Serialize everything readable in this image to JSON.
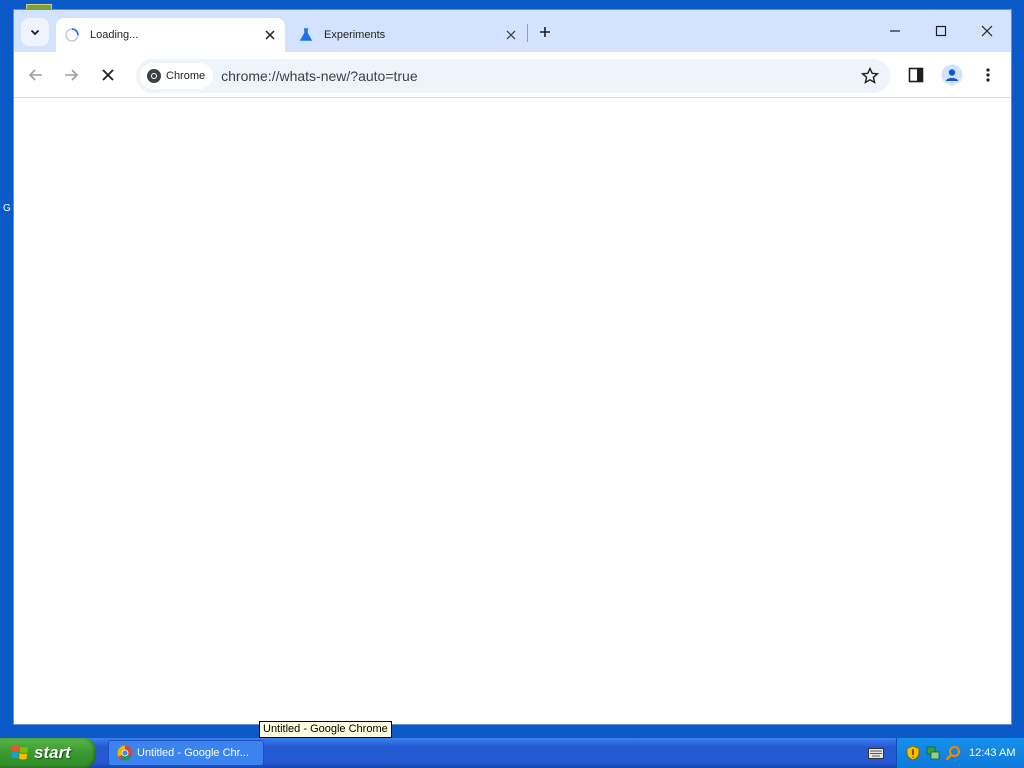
{
  "desktop": {
    "edge_letter": "G"
  },
  "browser": {
    "tabs": [
      {
        "title": "Loading...",
        "state": "loading",
        "icon": "spinner-icon"
      },
      {
        "title": "Experiments",
        "state": "inactive",
        "icon": "flask-icon"
      }
    ],
    "omnibox": {
      "chip_label": "Chrome",
      "url": "chrome://whats-new/?auto=true"
    },
    "colors": {
      "frame": "#d3e3fd",
      "omnibox": "#eff3fa",
      "accent": "#1a73e8"
    }
  },
  "taskbar": {
    "start_label": "start",
    "task_button_label": "Untitled - Google Chr...",
    "clock": "12:43 AM"
  },
  "tooltip": {
    "text": "Untitled - Google Chrome"
  }
}
